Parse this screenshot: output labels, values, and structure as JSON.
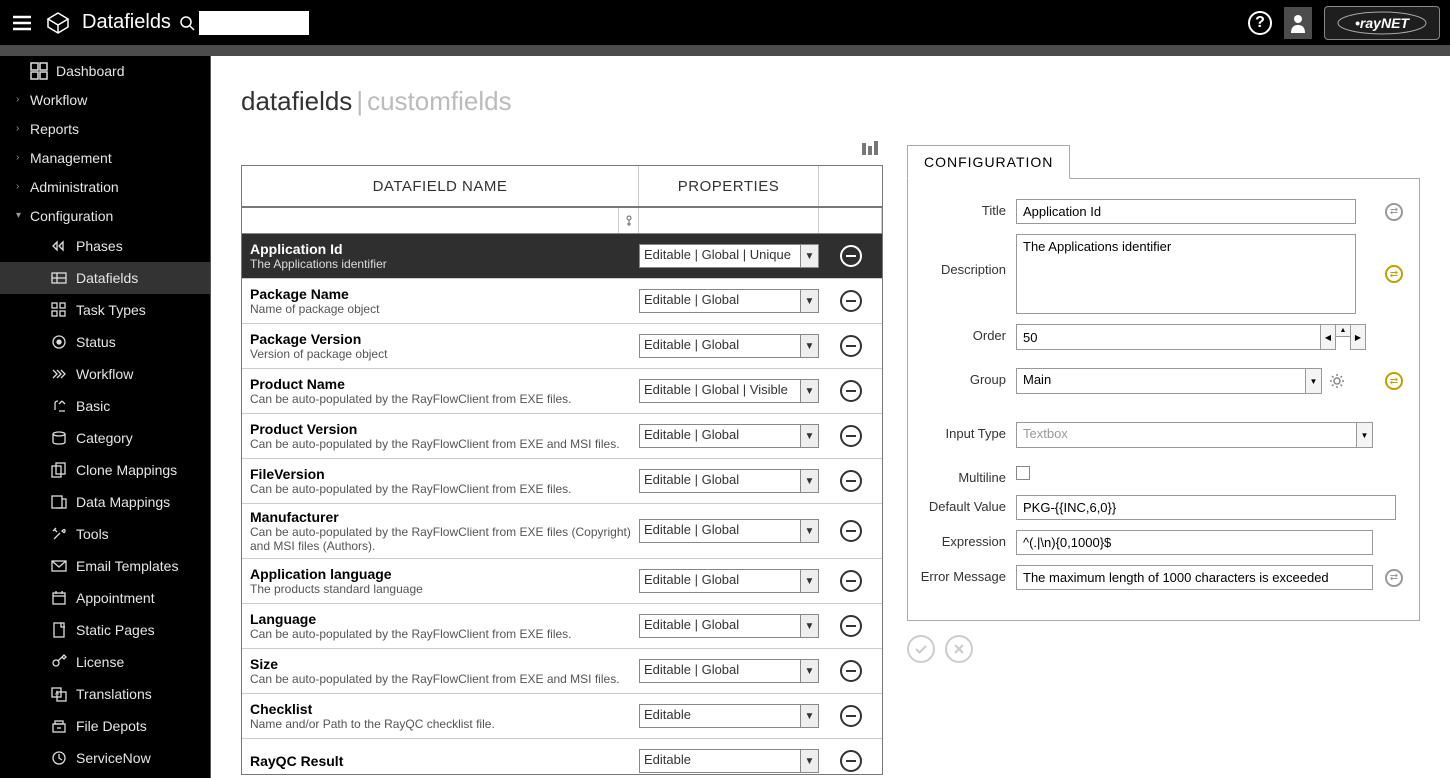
{
  "header": {
    "title": "Datafields",
    "help": "?",
    "brand": "rayNET"
  },
  "sidebar": {
    "dashboard": "Dashboard",
    "groups": [
      "Workflow",
      "Reports",
      "Management",
      "Administration",
      "Configuration"
    ],
    "config_items": [
      {
        "label": "Phases",
        "icon": "phases"
      },
      {
        "label": "Datafields",
        "icon": "datafields",
        "active": true
      },
      {
        "label": "Task Types",
        "icon": "tasktypes"
      },
      {
        "label": "Status",
        "icon": "status"
      },
      {
        "label": "Workflow",
        "icon": "workflow"
      },
      {
        "label": "Basic",
        "icon": "basic"
      },
      {
        "label": "Category",
        "icon": "category"
      },
      {
        "label": "Clone Mappings",
        "icon": "clone"
      },
      {
        "label": "Data Mappings",
        "icon": "datamap"
      },
      {
        "label": "Tools",
        "icon": "tools"
      },
      {
        "label": "Email Templates",
        "icon": "email"
      },
      {
        "label": "Appointment",
        "icon": "appointment"
      },
      {
        "label": "Static Pages",
        "icon": "static"
      },
      {
        "label": "License",
        "icon": "license"
      },
      {
        "label": "Translations",
        "icon": "translations"
      },
      {
        "label": "File Depots",
        "icon": "filedepots"
      },
      {
        "label": "ServiceNow",
        "icon": "servicenow"
      }
    ]
  },
  "breadcrumb": {
    "a": "datafields",
    "b": "customfields"
  },
  "grid": {
    "col1": "DATAFIELD NAME",
    "col2": "PROPERTIES",
    "rows": [
      {
        "name": "Application Id",
        "desc": "The Applications identifier",
        "props": "Editable | Global | Unique",
        "selected": true
      },
      {
        "name": "Package Name",
        "desc": "Name of package object",
        "props": "Editable | Global"
      },
      {
        "name": "Package Version",
        "desc": "Version of package object",
        "props": "Editable | Global"
      },
      {
        "name": "Product Name",
        "desc": "Can be auto-populated by the RayFlowClient from EXE files.",
        "props": "Editable | Global | Visible"
      },
      {
        "name": "Product Version",
        "desc": "Can be auto-populated by the RayFlowClient from EXE and MSI files.",
        "props": "Editable | Global"
      },
      {
        "name": "FileVersion",
        "desc": "Can be auto-populated by the RayFlowClient from EXE files.",
        "props": "Editable | Global"
      },
      {
        "name": "Manufacturer",
        "desc": "Can be auto-populated by the RayFlowClient from EXE files (Copyright) and MSI files (Authors).",
        "props": "Editable | Global"
      },
      {
        "name": "Application language",
        "desc": "The products standard language",
        "props": "Editable | Global"
      },
      {
        "name": "Language",
        "desc": "Can be auto-populated by the RayFlowClient from EXE files.",
        "props": "Editable | Global"
      },
      {
        "name": "Size",
        "desc": "Can be auto-populated by the RayFlowClient from EXE and MSI files.",
        "props": "Editable | Global"
      },
      {
        "name": "Checklist",
        "desc": "Name and/or Path to the RayQC checklist file.",
        "props": "Editable"
      },
      {
        "name": "RayQC Result",
        "desc": "",
        "props": "Editable"
      }
    ]
  },
  "config": {
    "tab": "CONFIGURATION",
    "title_lbl": "Title",
    "title_val": "Application Id",
    "desc_lbl": "Description",
    "desc_val": "The Applications identifier",
    "order_lbl": "Order",
    "order_val": "50",
    "group_lbl": "Group",
    "group_val": "Main",
    "input_lbl": "Input Type",
    "input_val": "Textbox",
    "multi_lbl": "Multiline",
    "default_lbl": "Default Value",
    "default_val": "PKG-{{INC,6,0}}",
    "expr_lbl": "Expression",
    "expr_val": "^(.|\\n){0,1000}$",
    "err_lbl": "Error Message",
    "err_val": "The maximum length of 1000 characters is exceeded"
  }
}
